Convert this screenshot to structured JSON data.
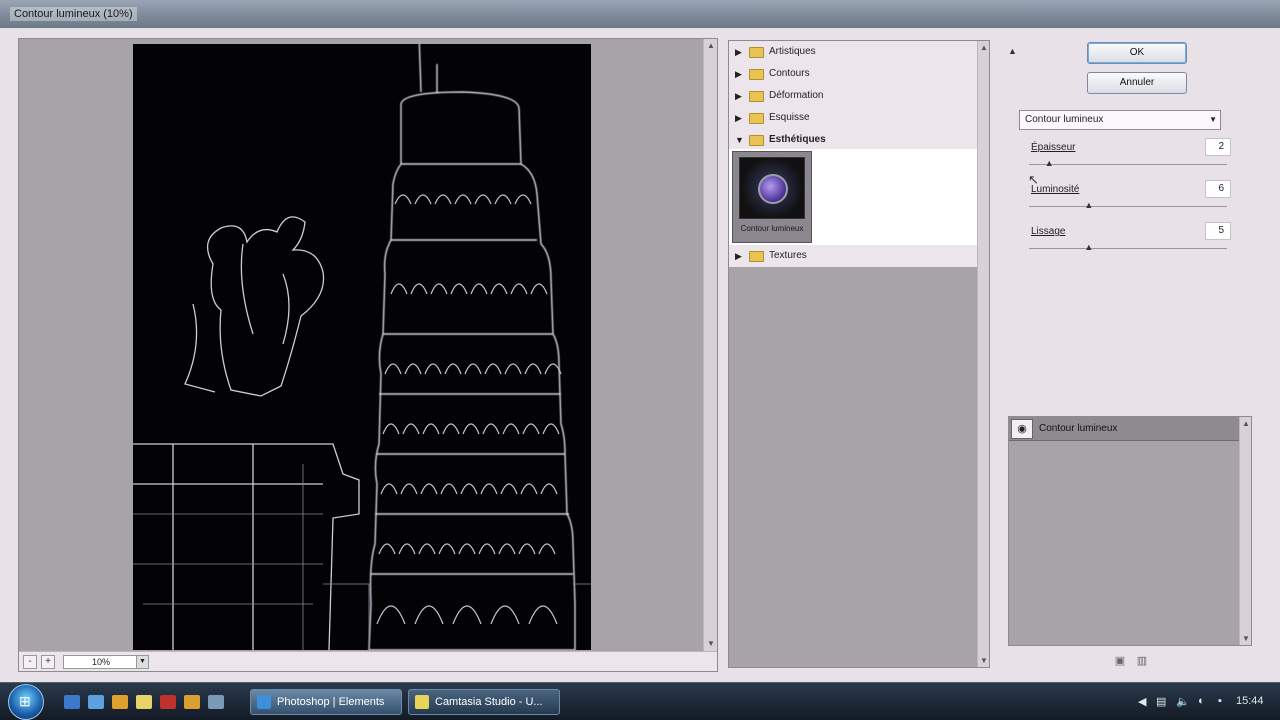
{
  "window": {
    "title": "Contour lumineux (10%)"
  },
  "preview": {
    "zoom_value": "10%",
    "zoom_minus": "-",
    "zoom_plus": "+"
  },
  "filter_tree": {
    "categories": [
      {
        "label": "Artistiques",
        "state": "collapsed"
      },
      {
        "label": "Contours",
        "state": "collapsed"
      },
      {
        "label": "Déformation",
        "state": "collapsed"
      },
      {
        "label": "Esquisse",
        "state": "collapsed"
      },
      {
        "label": "Esthétiques",
        "state": "expanded"
      },
      {
        "label": "Textures",
        "state": "collapsed"
      }
    ],
    "selected_thumbnail": {
      "label": "Contour lumineux"
    }
  },
  "buttons": {
    "ok": "OK",
    "cancel": "Annuler"
  },
  "filter_select": {
    "value": "Contour lumineux"
  },
  "parameters": [
    {
      "label": "Épaisseur",
      "value": "2",
      "level": 0.1
    },
    {
      "label": "Luminosité",
      "value": "6",
      "level": 0.3
    },
    {
      "label": "Lissage",
      "value": "5",
      "level": 0.3
    }
  ],
  "layers": [
    {
      "name": "Contour lumineux",
      "visible": true
    }
  ],
  "taskbar": {
    "start_label": "Start",
    "tasks": [
      {
        "label": "Photoshop | Elements",
        "active": true,
        "icon_color": "#3c8fd8"
      },
      {
        "label": "Camtasia Studio - U...",
        "active": false,
        "icon_color": "#e8d45a"
      }
    ],
    "clock": "15:44"
  },
  "colors": {
    "dialog_bg": "#e9e1e8",
    "panel_gray": "#a7a3a8",
    "canvas": "#030306",
    "folder": "#e8c455"
  }
}
